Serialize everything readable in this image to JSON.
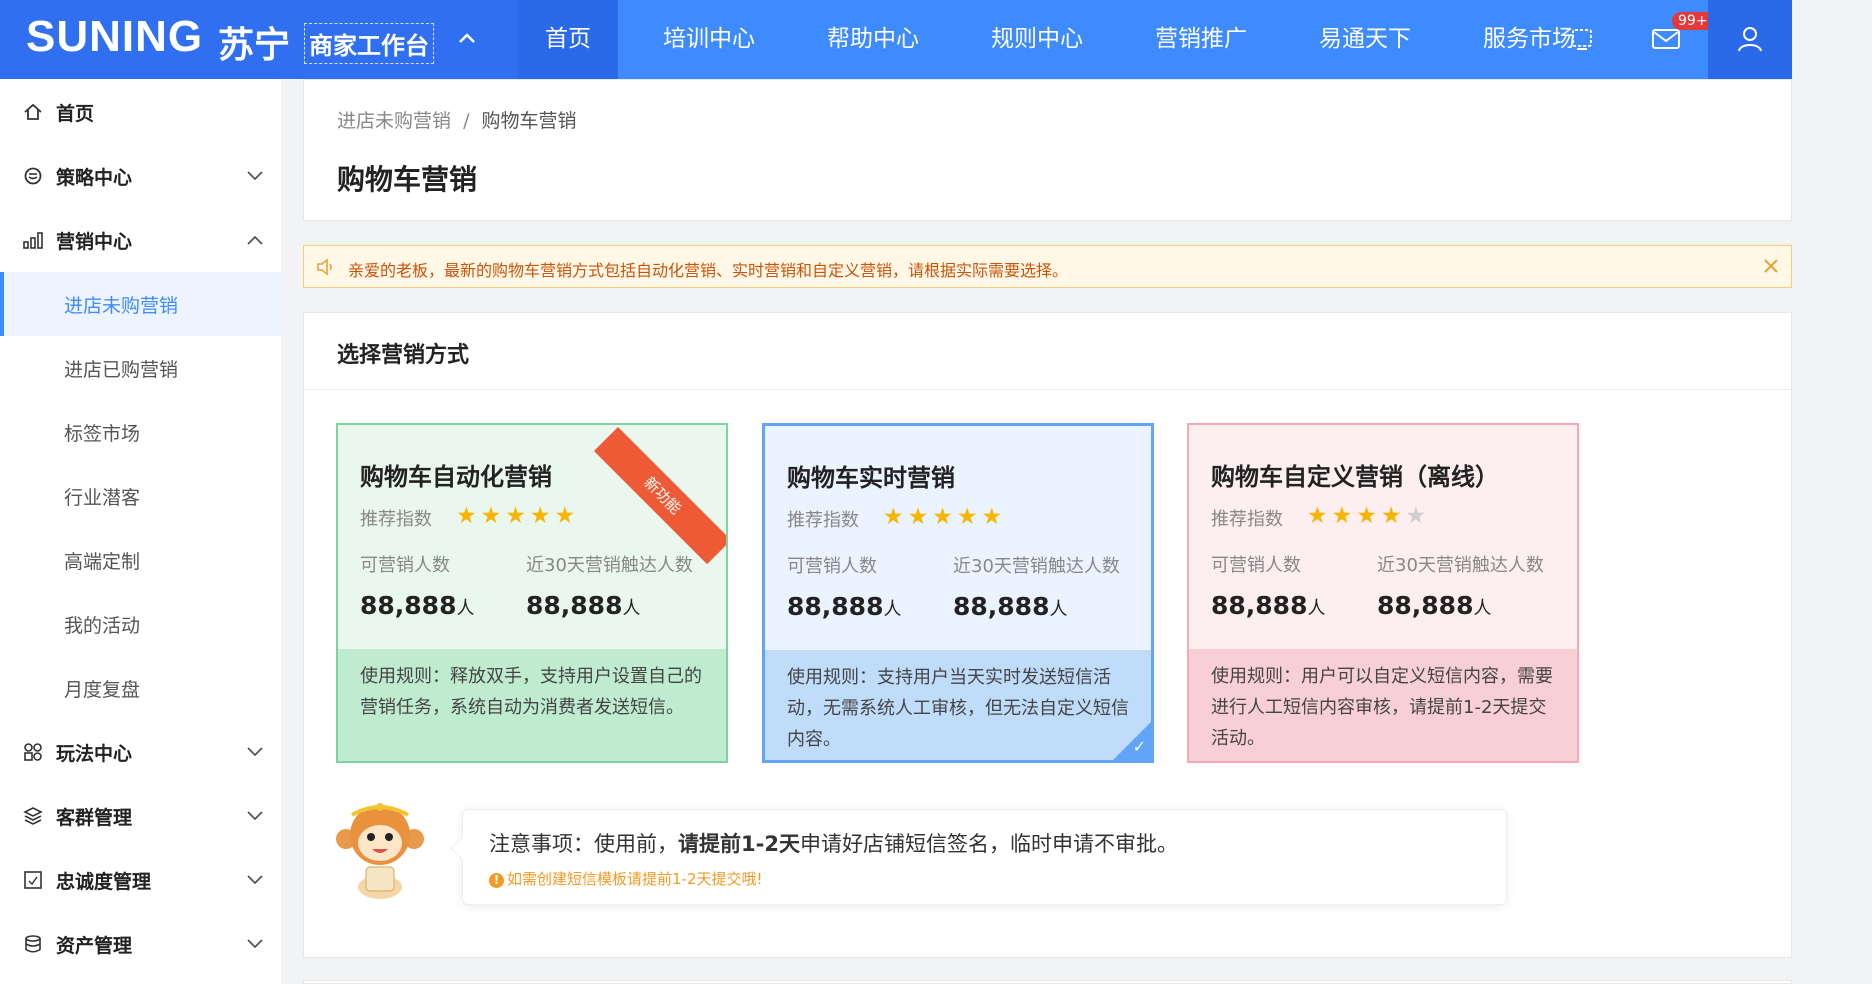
{
  "header": {
    "logo_text": "SUNING",
    "logo_cn": "苏宁",
    "logo_sub": "商家工作台",
    "nav": [
      "首页",
      "培训中心",
      "帮助中心",
      "规则中心",
      "营销推广",
      "易通天下",
      "服务市场"
    ],
    "badge": "99+",
    "accent": "#3d8bff"
  },
  "sidebar": {
    "items": [
      {
        "label": "首页",
        "icon": "home-icon"
      },
      {
        "label": "策略中心",
        "icon": "strategy-icon"
      },
      {
        "label": "营销中心",
        "icon": "bar-chart-icon"
      },
      {
        "label": "玩法中心",
        "icon": "grid-icon"
      },
      {
        "label": "客群管理",
        "icon": "layers-icon"
      },
      {
        "label": "忠诚度管理",
        "icon": "frame-icon"
      },
      {
        "label": "资产管理",
        "icon": "database-icon"
      }
    ],
    "sub_items": [
      "进店未购营销",
      "进店已购营销",
      "标签市场",
      "行业潜客",
      "高端定制",
      "我的活动",
      "月度复盘"
    ]
  },
  "page": {
    "breadcrumb_parent": "进店未购营销",
    "breadcrumb_sep": "/",
    "breadcrumb_current": "购物车营销",
    "title": "购物车营销"
  },
  "notice": {
    "text": "亲爱的老板，最新的购物车营销方式包括自动化营销、实时营销和自定义营销，请根据实际需要选择。"
  },
  "section": {
    "title": "选择营销方式"
  },
  "cards": [
    {
      "title": "购物车自动化营销",
      "ribbon": "新功能",
      "rating_label": "推荐指数",
      "rating": 5,
      "h1": "可营销人数",
      "h2": "近30天营销触达人数",
      "v1": "88,888",
      "v2": "88,888",
      "unit": "人",
      "rules": "使用规则：释放双手，支持用户设置自己的营销任务，系统自动为消费者发送短信。"
    },
    {
      "title": "购物车实时营销",
      "rating_label": "推荐指数",
      "rating": 5,
      "h1": "可营销人数",
      "h2": "近30天营销触达人数",
      "v1": "88,888",
      "v2": "88,888",
      "unit": "人",
      "rules": "使用规则：支持用户当天实时发送短信活动，无需系统人工审核，但无法自定义短信内容。",
      "selected": true
    },
    {
      "title": "购物车自定义营销（离线）",
      "rating_label": "推荐指数",
      "rating": 4,
      "h1": "可营销人数",
      "h2": "近30天营销触达人数",
      "v1": "88,888",
      "v2": "88,888",
      "unit": "人",
      "rules": "使用规则：用户可以自定义短信内容，需要进行人工短信内容审核，请提前1-2天提交活动。"
    }
  ],
  "tip": {
    "main_prefix": "注意事项：使用前，",
    "main_bold": "请提前1-2天",
    "main_suffix": "申请好店铺短信签名，临时申请不审批。",
    "sub": "如需创建短信模板请提前1-2天提交哦!"
  }
}
